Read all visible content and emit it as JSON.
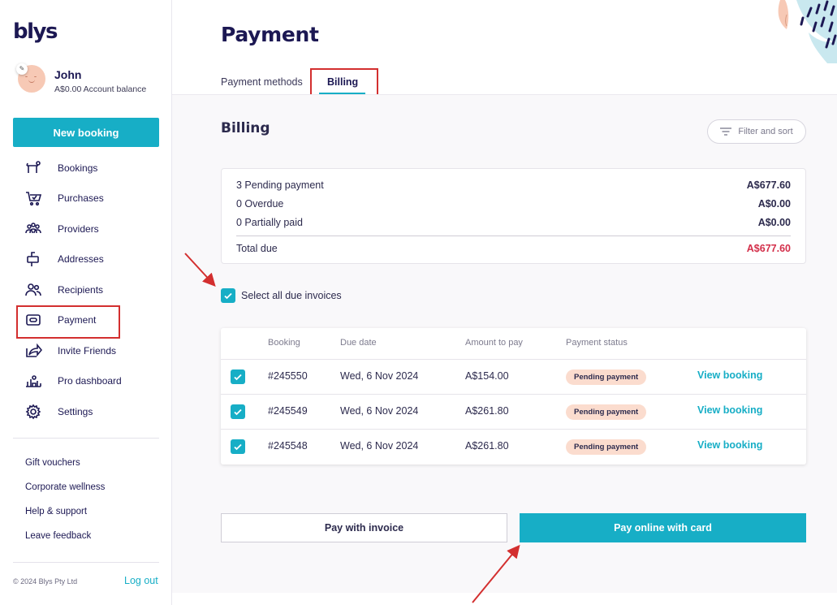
{
  "app": {
    "logo": "blys"
  },
  "profile": {
    "name": "John",
    "balance": "A$0.00 Account balance"
  },
  "new_booking_label": "New booking",
  "nav": [
    {
      "label": "Bookings",
      "icon": "massage-table-icon"
    },
    {
      "label": "Purchases",
      "icon": "cart-icon"
    },
    {
      "label": "Providers",
      "icon": "people-group-icon"
    },
    {
      "label": "Addresses",
      "icon": "mailbox-icon"
    },
    {
      "label": "Recipients",
      "icon": "users-icon"
    },
    {
      "label": "Payment",
      "icon": "wallet-icon"
    },
    {
      "label": "Invite Friends",
      "icon": "share-icon"
    },
    {
      "label": "Pro dashboard",
      "icon": "dashboard-icon"
    },
    {
      "label": "Settings",
      "icon": "gear-icon"
    }
  ],
  "sub_links": [
    "Gift vouchers",
    "Corporate wellness",
    "Help & support",
    "Leave feedback"
  ],
  "footer": {
    "copyright": "© 2024 Blys Pty Ltd",
    "logout": "Log out"
  },
  "page": {
    "title": "Payment"
  },
  "tabs": [
    {
      "label": "Payment methods",
      "active": false
    },
    {
      "label": "Billing",
      "active": true
    }
  ],
  "billing": {
    "title": "Billing",
    "filter_label": "Filter and sort",
    "summary": [
      {
        "label": "3 Pending payment",
        "amount": "A$677.60"
      },
      {
        "label": "0 Overdue",
        "amount": "A$0.00"
      },
      {
        "label": "0 Partially paid",
        "amount": "A$0.00"
      }
    ],
    "total": {
      "label": "Total due",
      "amount": "A$677.60"
    },
    "select_all_label": "Select all due invoices",
    "columns": [
      "Booking",
      "Due date",
      "Amount to pay",
      "Payment status"
    ],
    "rows": [
      {
        "booking": "#245550",
        "due_date": "Wed, 6 Nov 2024",
        "amount": "A$154.00",
        "status": "Pending payment",
        "action": "View booking"
      },
      {
        "booking": "#245549",
        "due_date": "Wed, 6 Nov 2024",
        "amount": "A$261.80",
        "status": "Pending payment",
        "action": "View booking"
      },
      {
        "booking": "#245548",
        "due_date": "Wed, 6 Nov 2024",
        "amount": "A$261.80",
        "status": "Pending payment",
        "action": "View booking"
      }
    ],
    "pay_invoice_label": "Pay with invoice",
    "pay_card_label": "Pay online with card"
  },
  "colors": {
    "accent": "#17aec6",
    "brand": "#1c1853",
    "alert": "#d32f4a",
    "badge": "#fbdcce",
    "annotation": "#d32f2f"
  }
}
